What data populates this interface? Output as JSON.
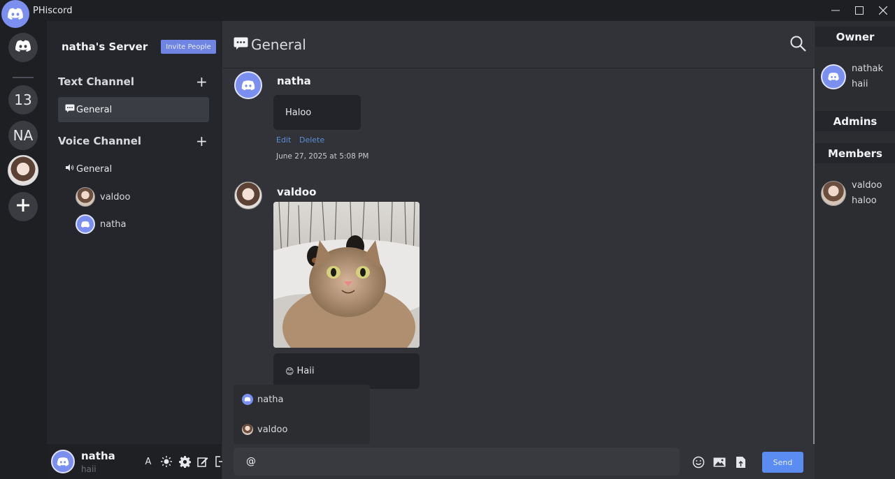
{
  "window": {
    "title": "PHiscord"
  },
  "rail": {
    "items": [
      {
        "label": "",
        "icon": "discord-icon"
      },
      {
        "label": "13"
      },
      {
        "label": "NA"
      },
      {
        "label": "",
        "icon": "avatar-photo"
      }
    ]
  },
  "sidebar": {
    "server_name": "natha's Server",
    "invite_label": "Invite People",
    "text_section": "Text Channel",
    "text_channels": [
      {
        "name": "General",
        "icon": "chat-icon"
      }
    ],
    "voice_section": "Voice Channel",
    "voice_channels": [
      {
        "name": "General",
        "icon": "speaker-icon"
      }
    ],
    "voice_users": [
      {
        "name": "valdoo"
      },
      {
        "name": "natha"
      }
    ]
  },
  "user_panel": {
    "name": "natha",
    "status": "haii",
    "font_label": "A"
  },
  "chat": {
    "channel_title": "General",
    "messages": [
      {
        "author": "natha",
        "text": "Haloo",
        "edit": "Edit",
        "delete": "Delete",
        "time": "June 27, 2025 at 5:08 PM"
      },
      {
        "author": "valdoo",
        "text": "Haii",
        "emoji": "😊"
      }
    ],
    "mention_suggestions": [
      {
        "name": "natha"
      },
      {
        "name": "valdoo"
      }
    ],
    "composer_value": "@",
    "send_label": "Send"
  },
  "members": {
    "owner_title": "Owner",
    "owner": {
      "name": "nathak",
      "status": "haii"
    },
    "admins_title": "Admins",
    "members_title": "Members",
    "member_list": [
      {
        "name": "valdoo",
        "status": "haloo"
      }
    ]
  },
  "colors": {
    "accent": "#6f84e3",
    "send": "#5b8cf2",
    "link": "#5b8ed8",
    "discord": "#7b8ff0"
  }
}
